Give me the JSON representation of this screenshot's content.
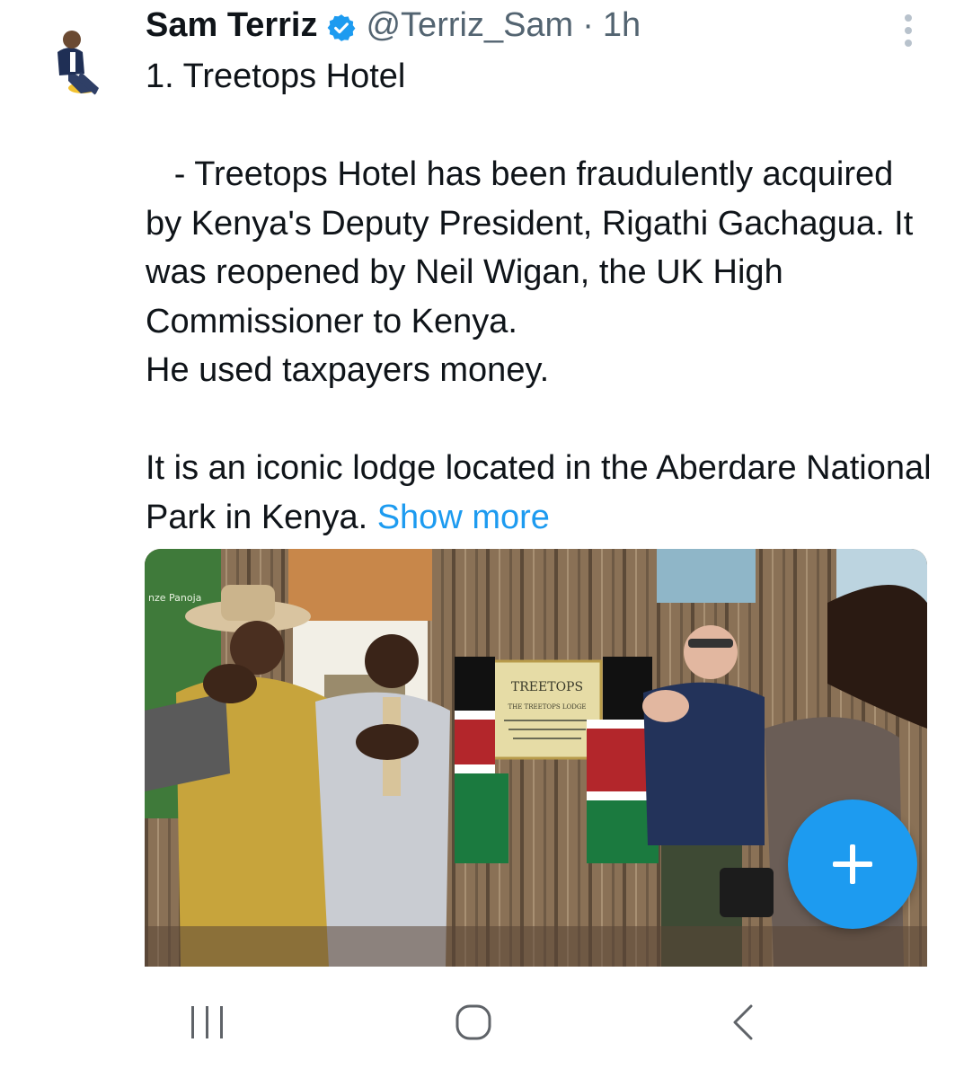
{
  "tweet": {
    "author_name": "Sam Terriz",
    "handle": "@Terriz_Sam",
    "separator": "·",
    "time": "1h",
    "paragraphs": [
      "1. Treetops Hotel",
      "",
      "   - Treetops Hotel has been fraudulently acquired by Kenya's Deputy President, Rigathi Gachagua. It was reopened by Neil Wigan, the UK High Commissioner to Kenya.",
      "He used taxpayers money.",
      "",
      "It is an iconic lodge located in the Aberdare National Park in Kenya."
    ],
    "show_more": "Show more",
    "verified": true
  },
  "media": {
    "sign_title": "TREETOPS",
    "sign_subtitle": "THE TREETOPS LODGE",
    "banner_text": "nze Panoja"
  },
  "icons": {
    "verified": "verified-badge-icon",
    "more": "more-vertical-icon",
    "compose": "plus-icon",
    "nav_recent": "recent-apps-icon",
    "nav_home": "home-icon",
    "nav_back": "back-icon"
  },
  "colors": {
    "accent": "#1d9bf0",
    "text": "#0f1419",
    "secondary": "#536471"
  }
}
